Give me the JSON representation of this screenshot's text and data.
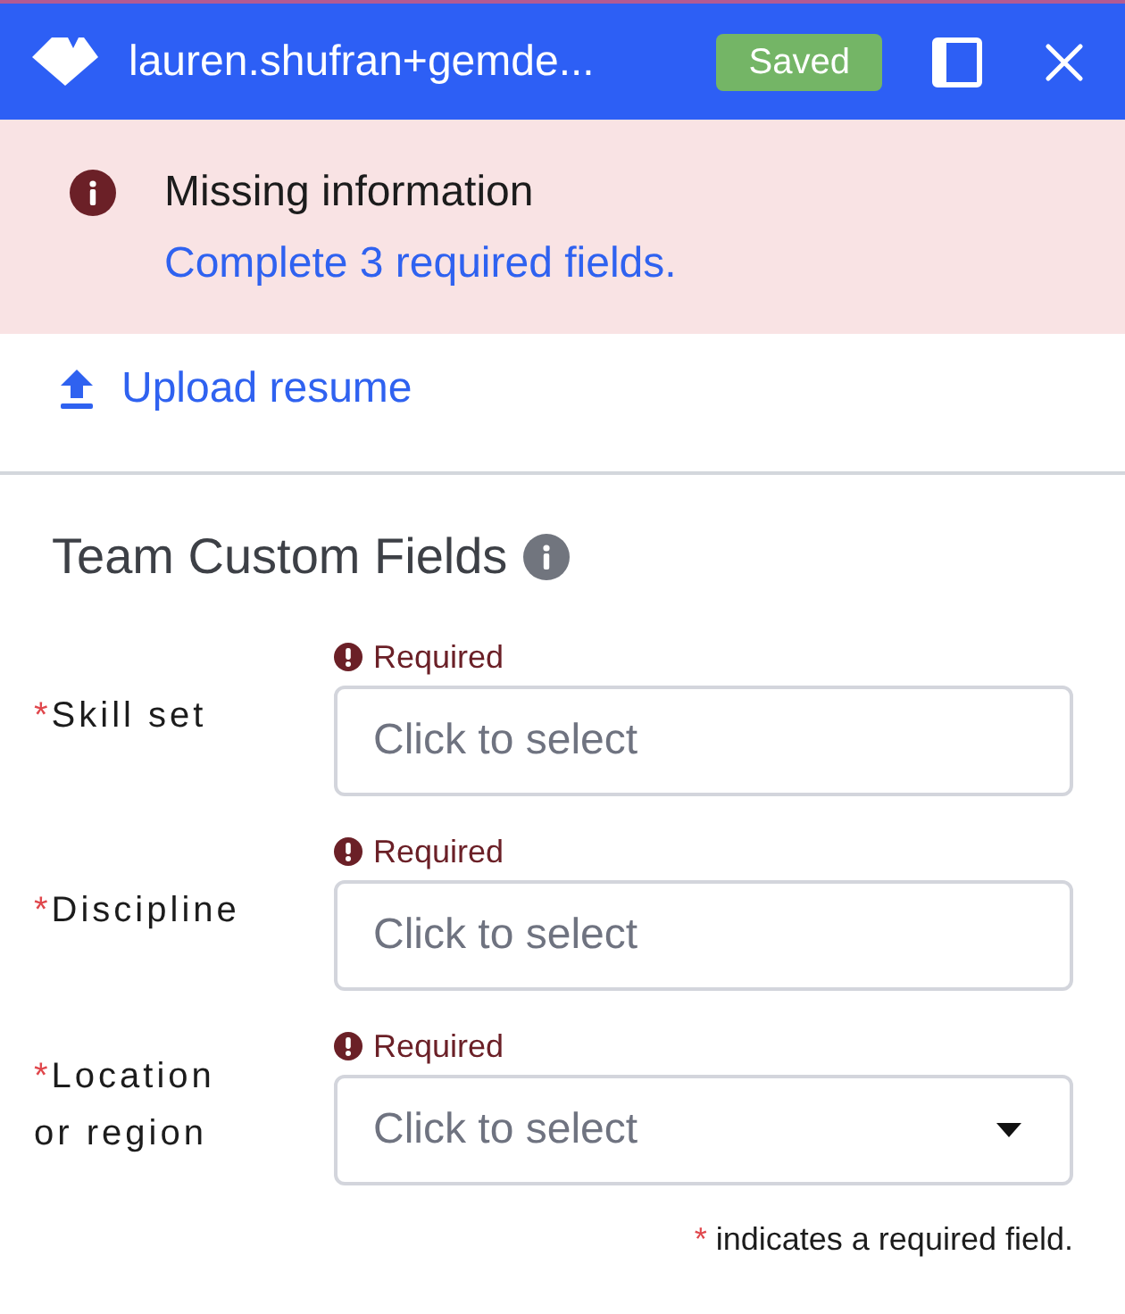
{
  "window": {
    "title": "lauren.shufran+gemde...",
    "badge": "Saved"
  },
  "alert": {
    "title": "Missing information",
    "message": "Complete 3 required fields."
  },
  "upload_link": {
    "label": "Upload resume"
  },
  "section": {
    "title": "Team Custom Fields"
  },
  "fields": [
    {
      "kind": "picker",
      "required_mark": "*",
      "label": "Skill set",
      "error": "Required",
      "placeholder": "Click to select"
    },
    {
      "kind": "picker",
      "required_mark": "*",
      "label": "Discipline",
      "error": "Required",
      "placeholder": "Click to select"
    },
    {
      "kind": "dropdown",
      "required_mark": "*",
      "label": "Location or region",
      "error": "Required",
      "placeholder": "Click to select"
    }
  ],
  "footnote": {
    "mark": "*",
    "text": "indicates a required field."
  }
}
